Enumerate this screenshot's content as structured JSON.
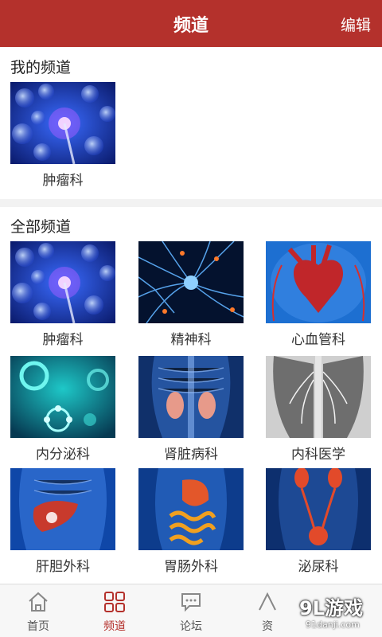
{
  "header": {
    "title": "频道",
    "edit_label": "编辑"
  },
  "my_channels": {
    "title": "我的频道",
    "items": [
      {
        "label": "肿瘤科",
        "image": "cells-image"
      }
    ]
  },
  "all_channels": {
    "title": "全部频道",
    "items": [
      {
        "label": "肿瘤科",
        "image": "cells-image"
      },
      {
        "label": "精神科",
        "image": "neurons-image"
      },
      {
        "label": "心血管科",
        "image": "heart-image"
      },
      {
        "label": "内分泌科",
        "image": "molecule-image"
      },
      {
        "label": "肾脏病科",
        "image": "kidney-image"
      },
      {
        "label": "内科医学",
        "image": "lungs-xray-image"
      },
      {
        "label": "肝胆外科",
        "image": "liver-image"
      },
      {
        "label": "胃肠外科",
        "image": "stomach-intestine-image"
      },
      {
        "label": "泌尿科",
        "image": "urinary-image"
      }
    ]
  },
  "tabbar": {
    "tabs": [
      {
        "label": "首页",
        "icon": "home-icon"
      },
      {
        "label": "频道",
        "icon": "grid-icon",
        "active": true
      },
      {
        "label": "论坛",
        "icon": "chat-icon"
      },
      {
        "label": "资",
        "icon": "info-icon"
      }
    ]
  },
  "watermark": {
    "main": "9L游戏",
    "sub": "91danji.com"
  },
  "colors": {
    "brand": "#b4312c",
    "active_tab": "#b4312c"
  }
}
